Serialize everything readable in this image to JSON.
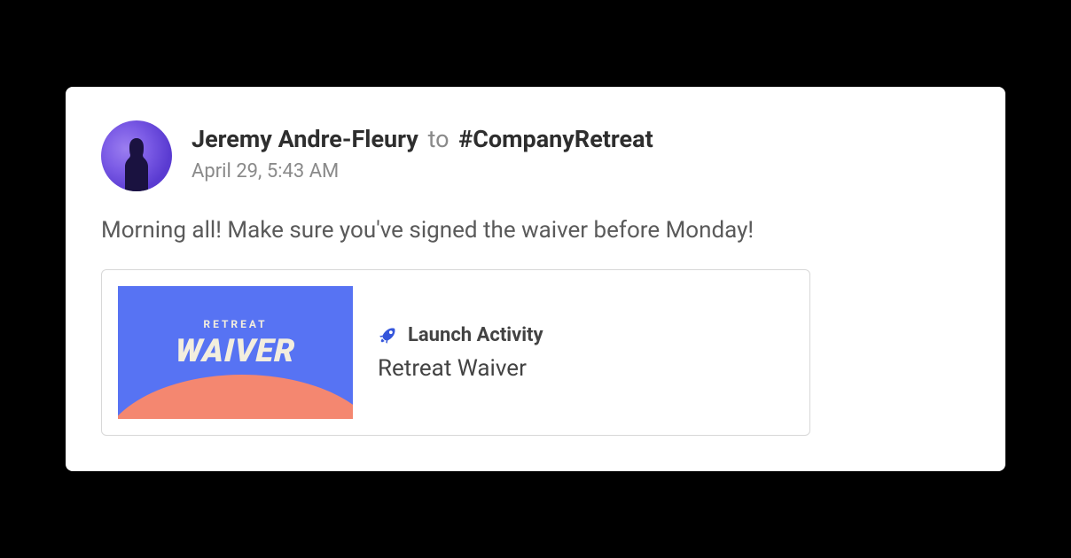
{
  "message": {
    "author": "Jeremy Andre-Fleury",
    "to_word": "to",
    "channel": "#CompanyRetreat",
    "timestamp": "April 29, 5:43 AM",
    "body": "Morning all! Make sure you've signed the waiver before Monday!"
  },
  "attachment": {
    "launch_label": "Launch Activity",
    "title": "Retreat Waiver",
    "thumbnail": {
      "subtitle": "RETREAT",
      "title": "WAIVER"
    }
  }
}
